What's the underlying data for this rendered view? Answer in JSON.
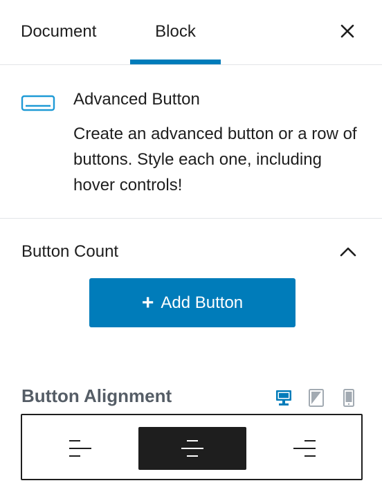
{
  "tabs": [
    {
      "label": "Document",
      "active": false
    },
    {
      "label": "Block",
      "active": true
    }
  ],
  "close_icon": "close-icon",
  "block": {
    "icon": "advanced-button-icon",
    "title": "Advanced Button",
    "description": "Create an advanced button or a row of buttons. Style each one, including hover controls!"
  },
  "button_count_panel": {
    "title": "Button Count",
    "expanded": true,
    "add_button_label": "Add Button"
  },
  "alignment": {
    "title": "Button Alignment",
    "devices": [
      "desktop-icon",
      "tablet-icon",
      "mobile-icon"
    ],
    "active_device": "desktop",
    "options": [
      "left",
      "center",
      "right"
    ],
    "selected": "center"
  },
  "colors": {
    "accent": "#007cba",
    "text": "#1e1e1e",
    "muted": "#555d66",
    "device_inactive": "#a2aab2",
    "border": "#e2e4e7"
  }
}
